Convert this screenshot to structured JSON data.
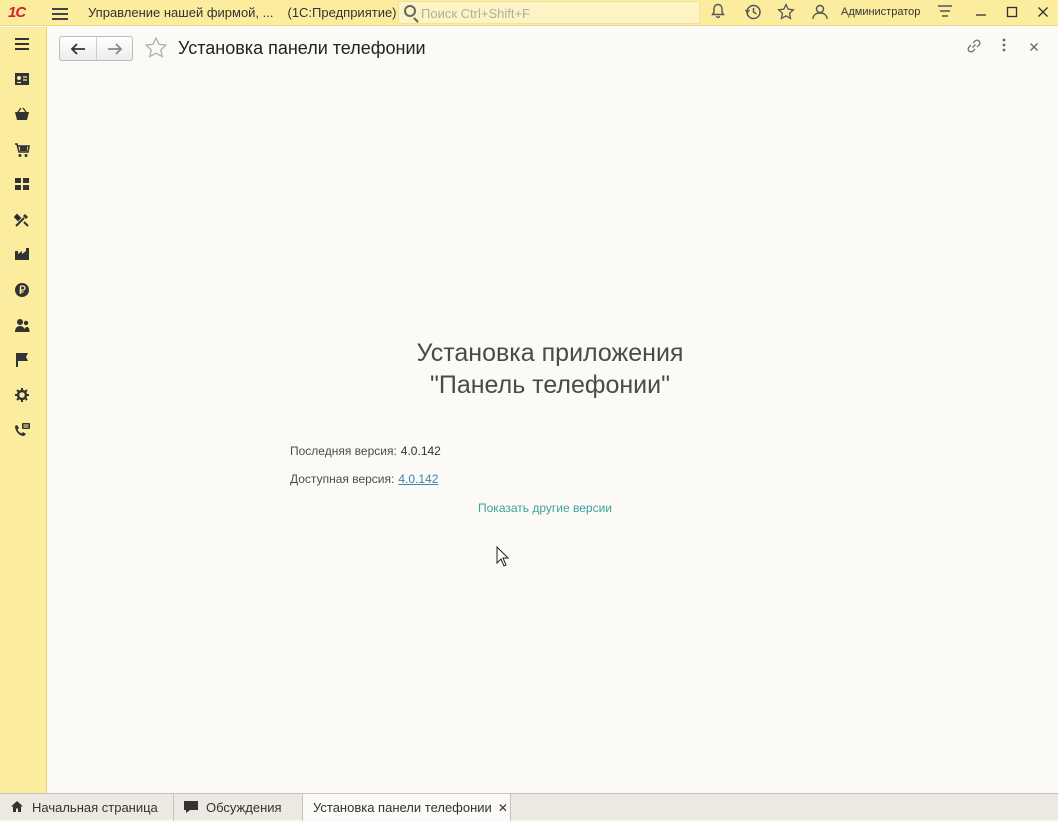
{
  "titlebar": {
    "logo": "1С",
    "app_title": "Управление нашей фирмой, ...",
    "app_platform": "(1С:Предприятие)",
    "search_placeholder": "Поиск Ctrl+Shift+F",
    "user": "Администратор"
  },
  "sidebar": {
    "items": [
      {
        "name": "main-menu-icon"
      },
      {
        "name": "crm-icon"
      },
      {
        "name": "sales-icon"
      },
      {
        "name": "purchases-icon"
      },
      {
        "name": "warehouse-icon"
      },
      {
        "name": "production-icon"
      },
      {
        "name": "factory-icon"
      },
      {
        "name": "money-icon"
      },
      {
        "name": "staff-icon"
      },
      {
        "name": "flag-icon"
      },
      {
        "name": "settings-icon"
      },
      {
        "name": "telephony-icon"
      }
    ]
  },
  "form": {
    "title": "Установка панели телефонии",
    "heading_line1": "Установка приложения",
    "heading_line2": "\"Панель телефонии\"",
    "latest_label": "Последняя версия:",
    "latest_value": "4.0.142",
    "available_label": "Доступная версия:",
    "available_value": "4.0.142",
    "show_versions": "Показать другие версии"
  },
  "tabs": [
    {
      "label": "Начальная страница",
      "icon": "home-icon"
    },
    {
      "label": "Обсуждения",
      "icon": "chat-icon"
    },
    {
      "label": "Установка панели телефонии",
      "icon": "",
      "active": true
    }
  ],
  "colors": {
    "panel_bg": "#fbec9e",
    "link": "#3a84b7",
    "accent_link": "#3ea0a0",
    "logo_red": "#d5232a"
  }
}
